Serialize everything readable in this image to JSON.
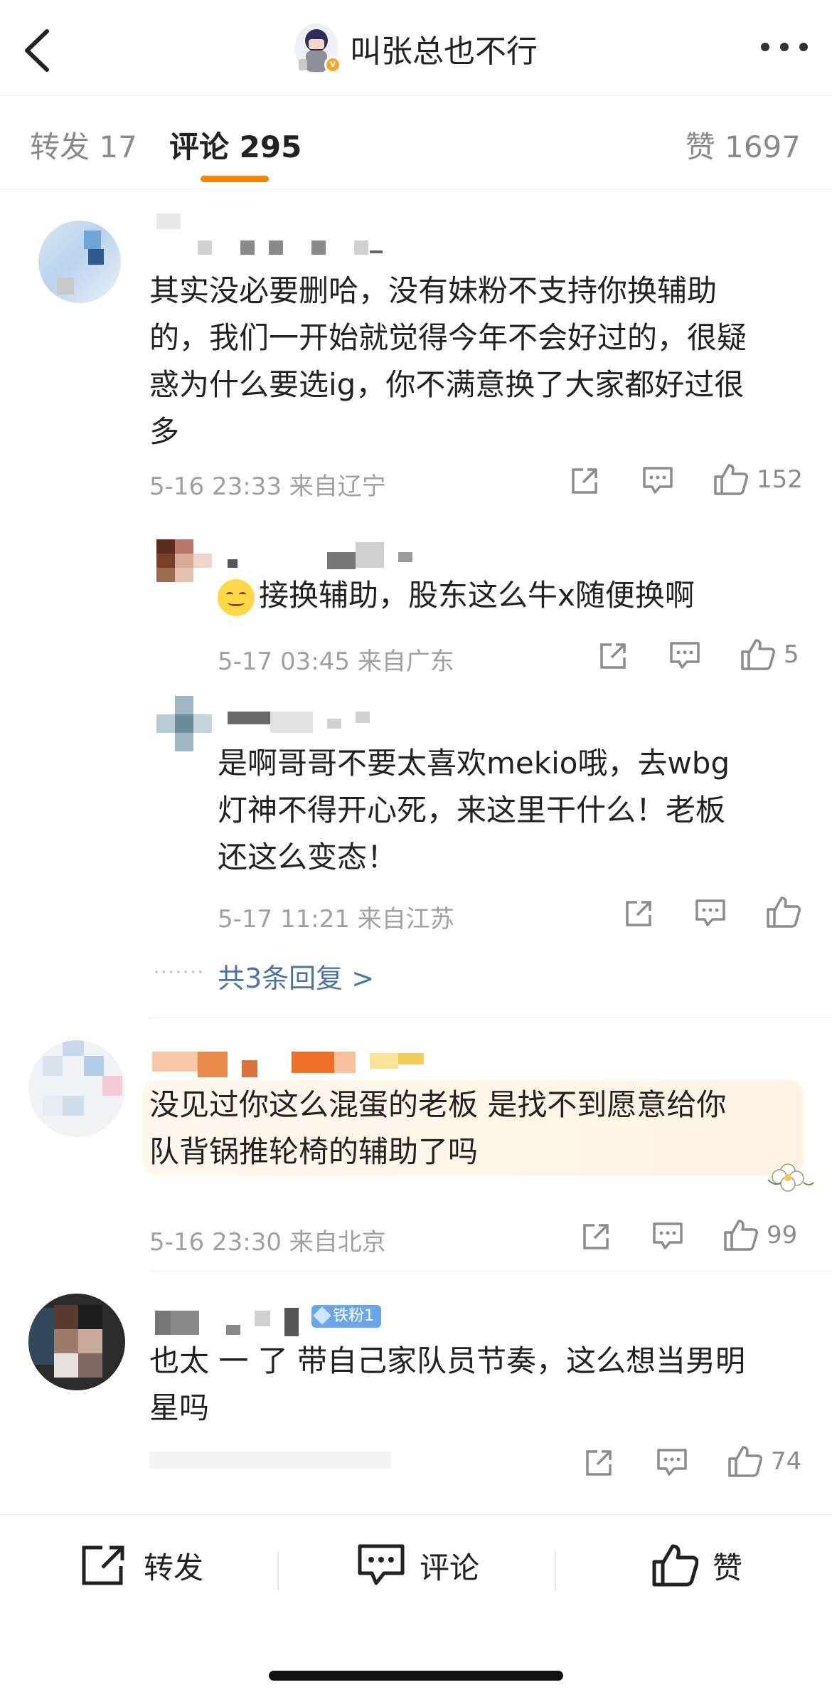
{
  "header": {
    "title": "叫张总也不行",
    "back_icon": "chevron-left-icon",
    "more_icon": "more-horizontal-icon"
  },
  "tabs": {
    "repost": "转发 17",
    "comment": "评论 295",
    "like": "赞 1697",
    "accent_color": "#ff8200"
  },
  "comments": [
    {
      "text_lines": [
        "其实没必要删哈，没有妹粉不支持你换辅助",
        "的，我们一开始就觉得今年不会好过的，很疑",
        "惑为什么要选ig，你不满意换了大家都好过很",
        "多"
      ],
      "time_location": "5-16 23:33 来自辽宁",
      "likes": "152",
      "replies": [
        {
          "text": "接换辅助，股东这么牛x随便换啊",
          "time_location": "5-17 03:45 来自广东",
          "likes": "5"
        },
        {
          "text_lines": [
            "是啊哥哥不要太喜欢mekio哦，去wbg",
            "灯神不得开心死，来这里干什么！老板",
            "还这么变态！"
          ],
          "time_location": "5-17 11:21 来自江苏",
          "likes": ""
        }
      ],
      "more_replies": "共3条回复 >"
    },
    {
      "text_lines": [
        "没见过你这么混蛋的老板 是找不到愿意给你",
        "队背锅推轮椅的辅助了吗"
      ],
      "time_location": "5-16 23:30 来自北京",
      "likes": "99"
    },
    {
      "badge": "铁粉1",
      "text_lines": [
        "也太 一 了 带自己家队员节奏，这么想当男明",
        "星吗"
      ],
      "likes": "74"
    }
  ],
  "bottom_bar": {
    "repost": "转发",
    "comment": "评论",
    "like": "赞"
  }
}
